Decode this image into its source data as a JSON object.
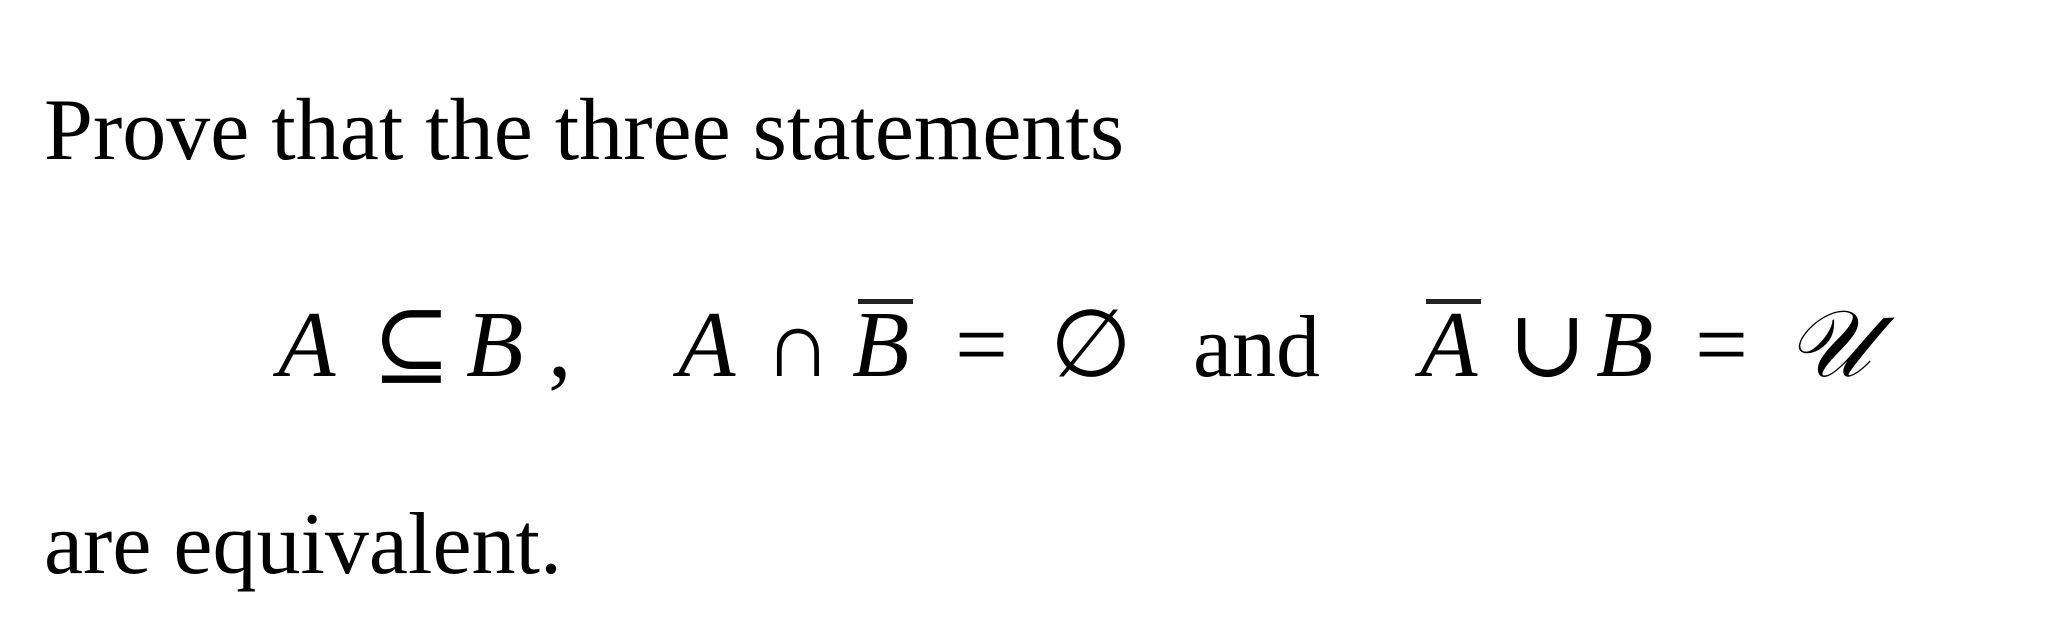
{
  "document": {
    "intro": "Prove that the three statements",
    "statements": [
      {
        "id": "subset",
        "parts": {
          "lhs": "A",
          "rel": "⊆",
          "rhs": "B",
          "sep": ","
        }
      },
      {
        "id": "intersection",
        "parts": {
          "a": "A",
          "op": "∩",
          "b": "B",
          "b_complement": true,
          "eq": "=",
          "result": "∅"
        }
      },
      {
        "id": "union",
        "parts": {
          "a": "A",
          "a_complement": true,
          "op": "∪",
          "b": "B",
          "eq": "=",
          "result": "𝒰"
        }
      }
    ],
    "conjunction": "and",
    "conclusion": "are equivalent."
  }
}
